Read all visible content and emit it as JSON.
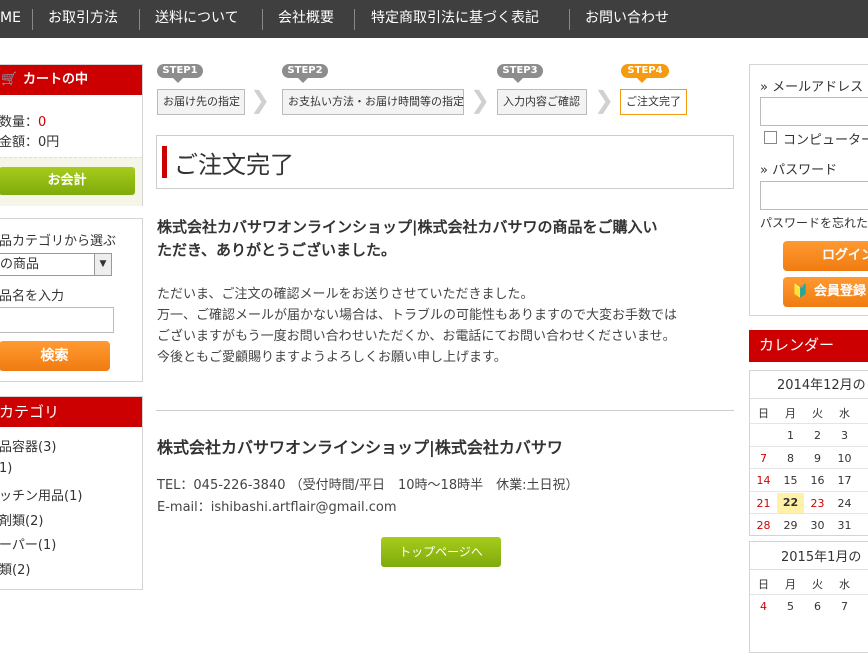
{
  "nav": {
    "items": [
      "ME",
      "お取引方法",
      "送料について",
      "会社概要",
      "特定商取引法に基づく表記",
      "お問い合わせ"
    ]
  },
  "cart": {
    "title": "カートの中",
    "qty_label": "数量：",
    "qty_value": "0",
    "amount_label": "金額：0円",
    "checkout_label": "お会計"
  },
  "search": {
    "category_label": "品カテゴリから選ぶ",
    "category_selected": "の商品",
    "name_label": "品名を入力",
    "name_value": "",
    "button_label": "検索"
  },
  "category": {
    "title": "カテゴリ",
    "items": [
      "品容器(3)",
      "1)",
      "ッチン用品(1)",
      "剤類(2)",
      "ーパー(1)",
      "類(2)"
    ]
  },
  "steps": [
    {
      "tag": "STEP1",
      "label": "お届け先の指定",
      "active": false
    },
    {
      "tag": "STEP2",
      "label": "お支払い方法・お届け時間等の指定",
      "active": false
    },
    {
      "tag": "STEP3",
      "label": "入力内容ご確認",
      "active": false
    },
    {
      "tag": "STEP4",
      "label": "ご注文完了",
      "active": true
    }
  ],
  "main": {
    "page_title": "ご注文完了",
    "thanks_line1": "株式会社カバサワオンラインショップ|株式会社カバサワの商品をご購入い",
    "thanks_line2": "ただき、ありがとうございました。",
    "body_lines": [
      "ただいま、ご注文の確認メールをお送りさせていただきました。",
      "万一、ご確認メールが届かない場合は、トラブルの可能性もありますので大変お手数では",
      "ございますがもう一度お問い合わせいただくか、お電話にてお問い合わせくださいませ。",
      "今後ともご愛顧賜りますようよろしくお願い申し上げます。"
    ],
    "shop_name": "株式会社カバサワオンラインショップ|株式会社カバサワ",
    "tel": "TEL：045-226-3840 （受付時間/平日　10時～18時半　休業:土日祝）",
    "email": "E-mail：ishibashi.artflair@gmail.com",
    "top_button": "トップページへ"
  },
  "login": {
    "email_label": "メールアドレス",
    "email_value": "",
    "remember_label": "コンピューター",
    "password_label": "パスワード",
    "password_value": "",
    "forgot_label": "パスワードを忘れた",
    "login_button": "ログイン",
    "register_button": "会員登録"
  },
  "calendar": {
    "title": "カレンダー",
    "weekdays": [
      "日",
      "月",
      "火",
      "水"
    ],
    "month1": {
      "title": "2014年12月の",
      "weeks": [
        [
          "",
          "1",
          "2",
          "3"
        ],
        [
          "7",
          "8",
          "9",
          "10"
        ],
        [
          "14",
          "15",
          "16",
          "17"
        ],
        [
          "21",
          "22",
          "23",
          "24"
        ],
        [
          "28",
          "29",
          "30",
          "31"
        ]
      ],
      "today": "22"
    },
    "month2": {
      "title": "2015年1月の",
      "weeks": [
        [
          "4",
          "5",
          "6",
          "7"
        ]
      ]
    },
    "colors": {
      "holiday": "#d40000",
      "today_bg": "#fff2a8"
    }
  },
  "colors": {
    "nav_bg": "#3f3f3f",
    "accent_red": "#cc0000",
    "accent_orange": "#f49b12",
    "button_green": "#8ab414"
  }
}
